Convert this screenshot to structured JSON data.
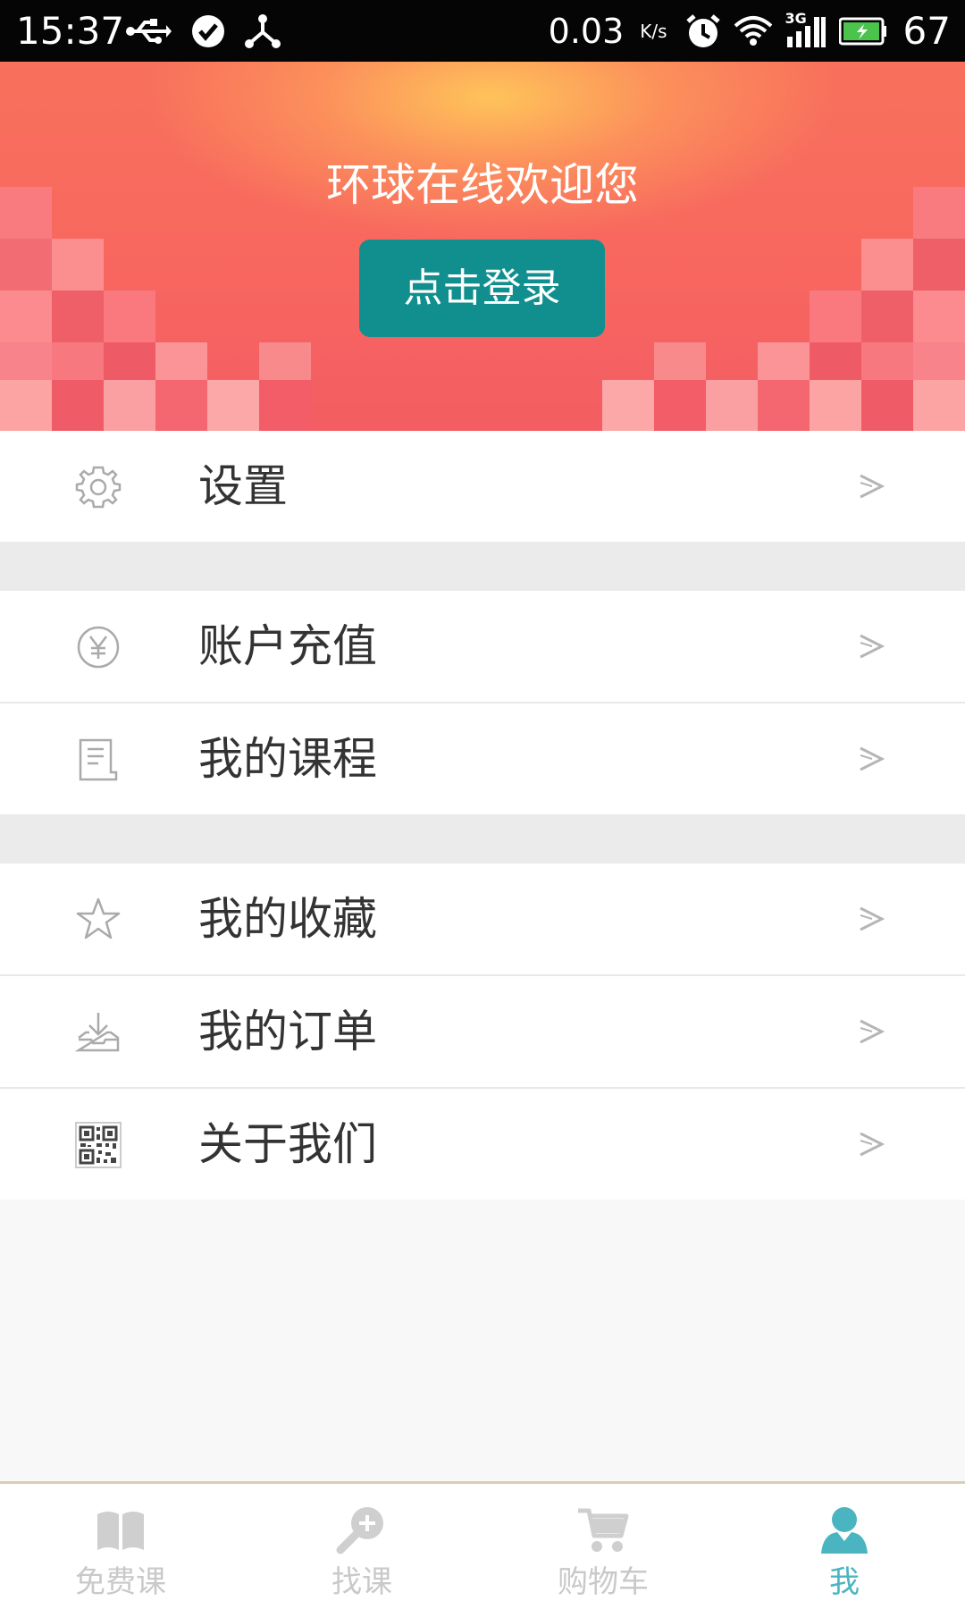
{
  "status_bar": {
    "time": "15:37",
    "net_speed": "0.03",
    "net_speed_unit": "K/s",
    "network_type": "3G",
    "battery_level": "67",
    "left_icons": [
      "usb-icon",
      "check-circle-icon",
      "share-hub-icon"
    ],
    "right_icons": [
      "alarm-icon",
      "wifi-icon",
      "signal-icon",
      "battery-icon"
    ]
  },
  "hero": {
    "welcome_text": "环球在线欢迎您",
    "login_button": "点击登录",
    "colors": {
      "background": "#f8675f",
      "glow": "#ffc85a",
      "button": "#118f8f"
    }
  },
  "menu": {
    "groups": [
      {
        "items": [
          {
            "id": "settings",
            "label": "设置",
            "icon": "gear-icon"
          }
        ]
      },
      {
        "items": [
          {
            "id": "recharge",
            "label": "账户充值",
            "icon": "yen-coin-icon"
          },
          {
            "id": "my-courses",
            "label": "我的课程",
            "icon": "document-icon"
          }
        ]
      },
      {
        "items": [
          {
            "id": "favorites",
            "label": "我的收藏",
            "icon": "star-icon"
          },
          {
            "id": "orders",
            "label": "我的订单",
            "icon": "download-tray-icon"
          },
          {
            "id": "about",
            "label": "关于我们",
            "icon": "qr-code-icon"
          }
        ]
      }
    ],
    "chevron_icon": "chevron-right-icon"
  },
  "bottom_nav": {
    "tabs": [
      {
        "label": "免费课",
        "icon": "book-icon",
        "active": false
      },
      {
        "label": "找课",
        "icon": "search-plus-icon",
        "active": false
      },
      {
        "label": "购物车",
        "icon": "cart-icon",
        "active": false
      },
      {
        "label": "我",
        "icon": "user-icon",
        "active": true
      }
    ],
    "colors": {
      "active": "#4ab5c0",
      "inactive": "#c9c9c9"
    }
  }
}
